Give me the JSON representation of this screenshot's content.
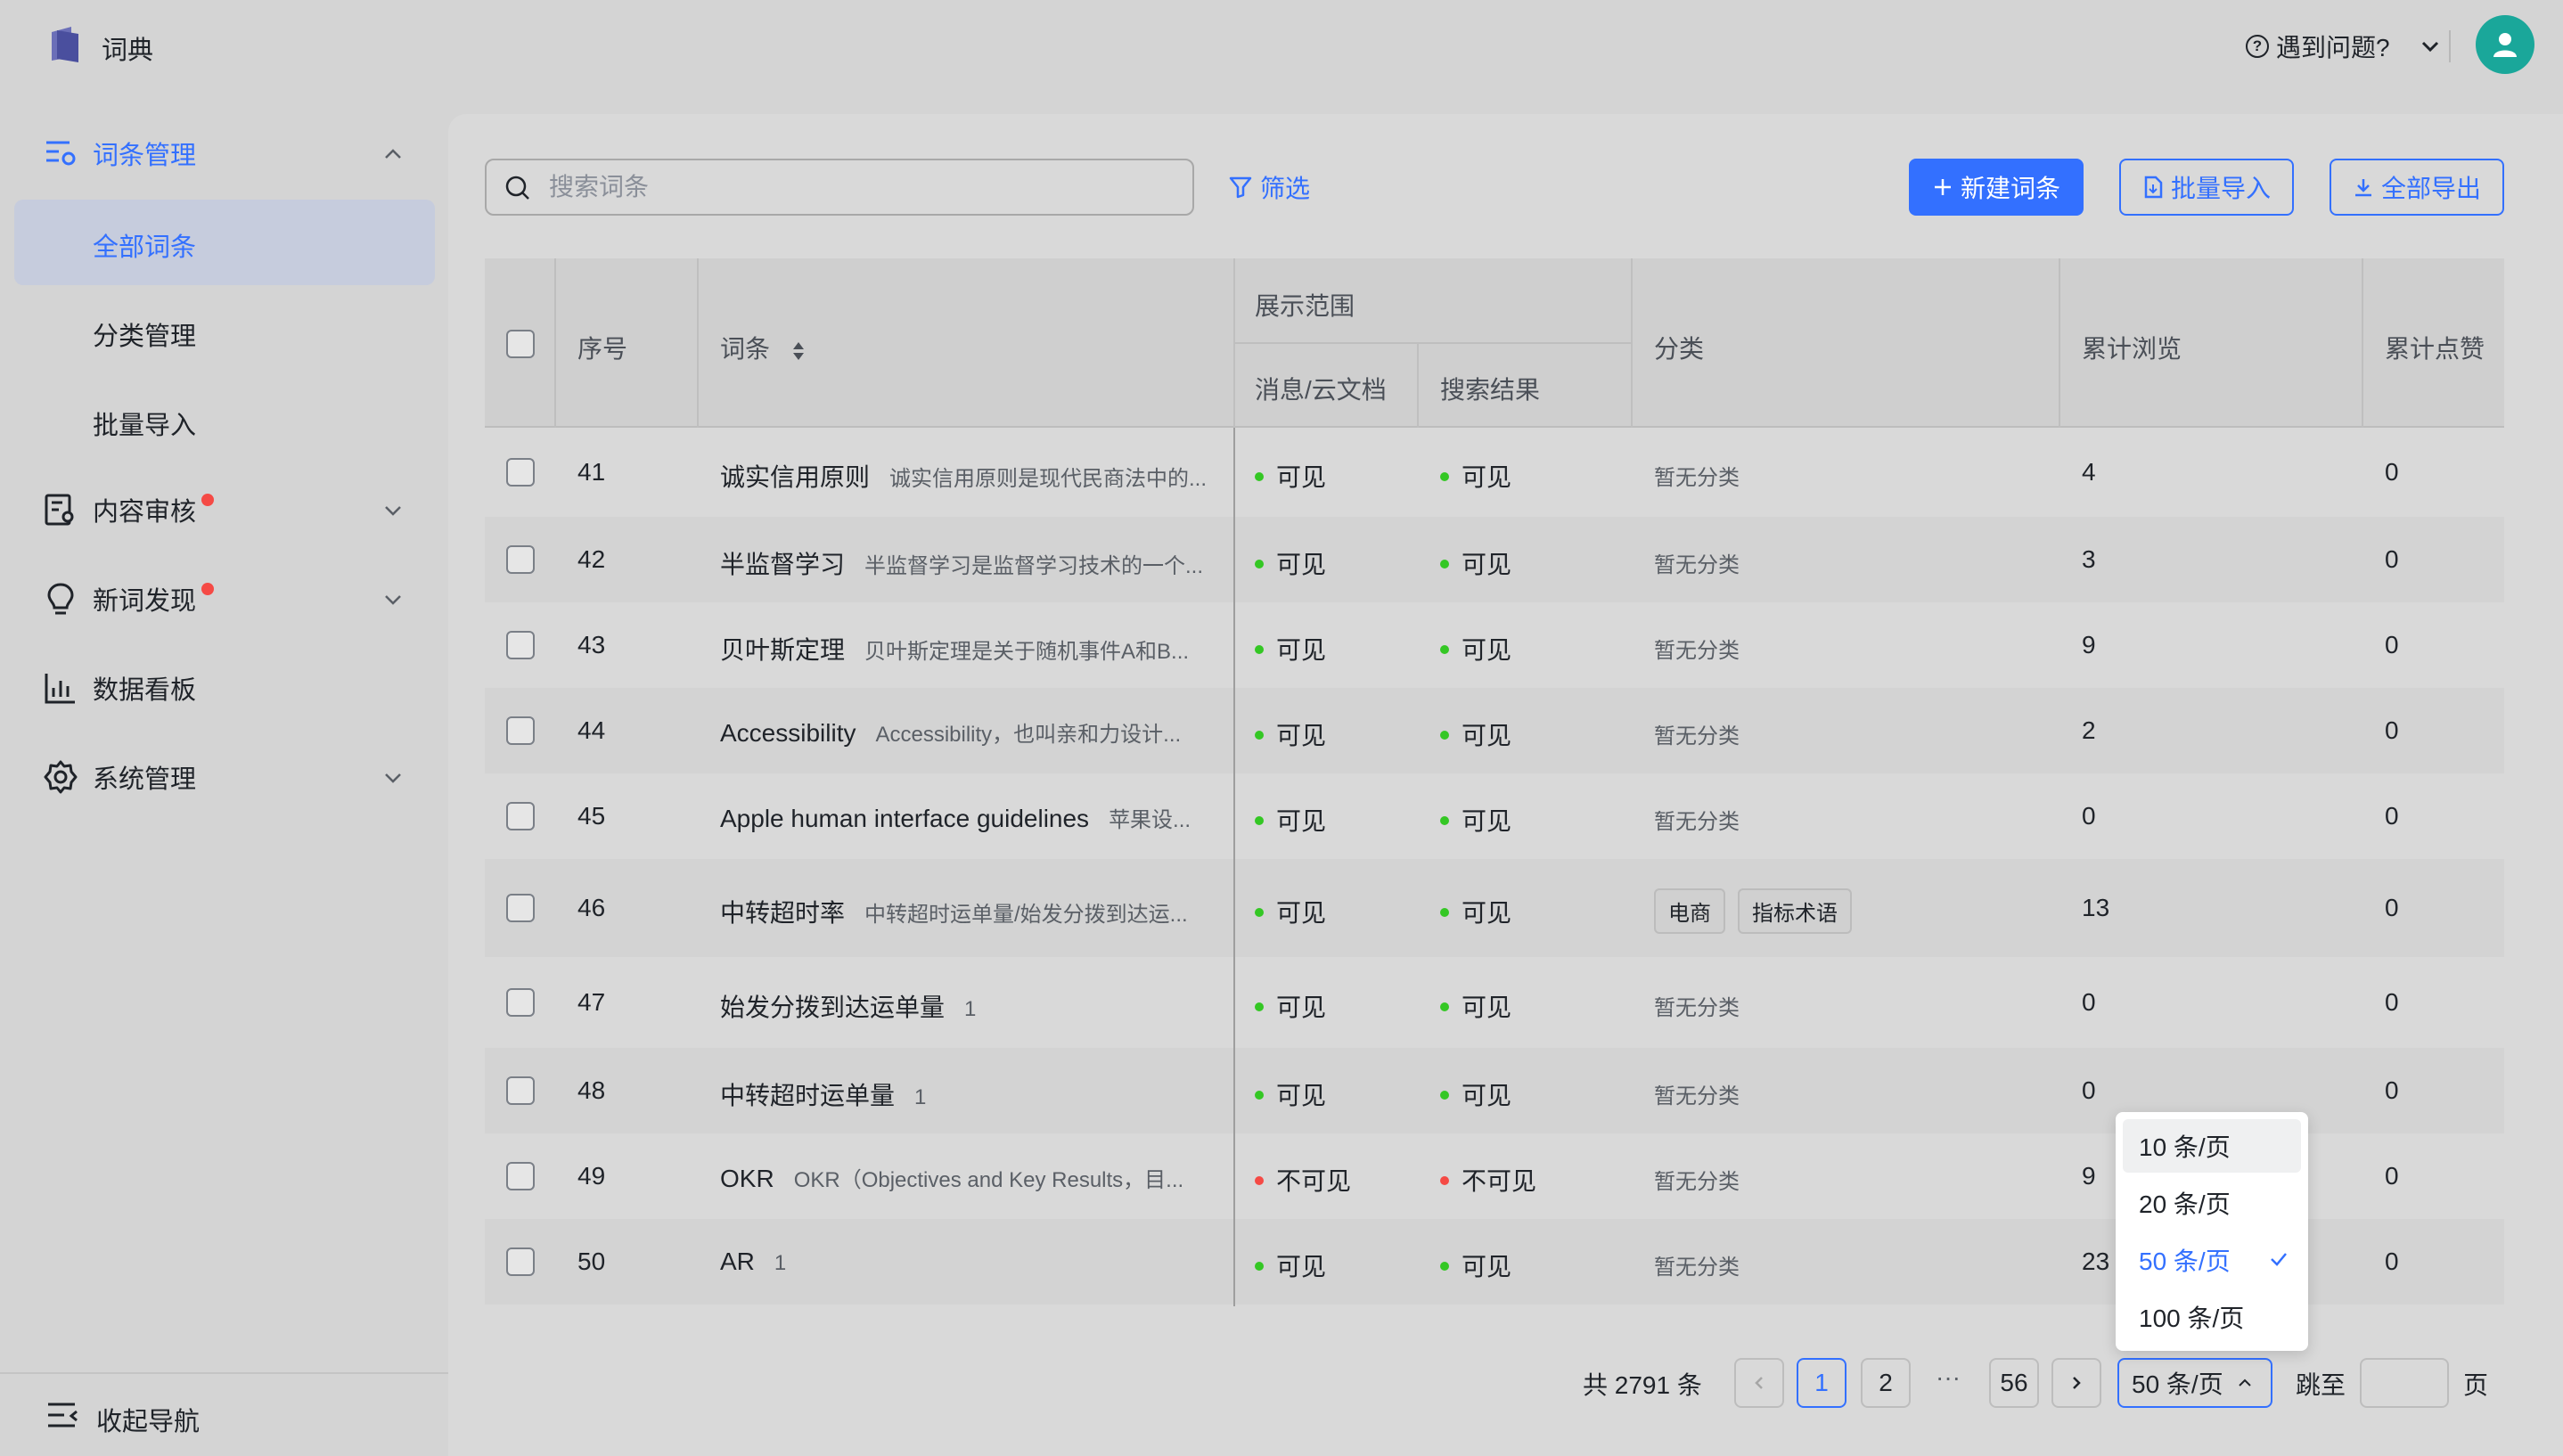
{
  "header": {
    "app_title": "词典",
    "help_label": "遇到问题?"
  },
  "sidebar": {
    "items": [
      {
        "label": "词条管理",
        "icon": "list-settings-icon",
        "expanded": true,
        "badge": false
      },
      {
        "label": "内容审核",
        "icon": "audit-icon",
        "expanded": false,
        "badge": true
      },
      {
        "label": "新词发现",
        "icon": "lightbulb-icon",
        "expanded": false,
        "badge": true
      },
      {
        "label": "数据看板",
        "icon": "bar-chart-icon",
        "badge": false
      },
      {
        "label": "系统管理",
        "icon": "gear-icon",
        "expanded": false,
        "badge": false
      }
    ],
    "sub_items": [
      {
        "label": "全部词条",
        "selected": true
      },
      {
        "label": "分类管理",
        "selected": false
      },
      {
        "label": "批量导入",
        "selected": false
      }
    ],
    "collapse_label": "收起导航"
  },
  "toolbar": {
    "search_placeholder": "搜索词条",
    "filter_label": "筛选",
    "new_label": "新建词条",
    "import_label": "批量导入",
    "export_label": "全部导出"
  },
  "table": {
    "headers": {
      "index": "序号",
      "term": "词条",
      "scope": "展示范围",
      "scope_msg": "消息/云文档",
      "scope_search": "搜索结果",
      "category": "分类",
      "views": "累计浏览",
      "likes": "累计点赞"
    },
    "rows": [
      {
        "index": "41",
        "term": "诚实信用原则",
        "desc": "诚实信用原则是现代民商法中的...",
        "msg": "可见",
        "msg_ok": true,
        "search": "可见",
        "search_ok": true,
        "category": "暂无分类",
        "tags": [],
        "views": "4",
        "likes": "0"
      },
      {
        "index": "42",
        "term": "半监督学习",
        "desc": "半监督学习是监督学习技术的一个...",
        "msg": "可见",
        "msg_ok": true,
        "search": "可见",
        "search_ok": true,
        "category": "暂无分类",
        "tags": [],
        "views": "3",
        "likes": "0"
      },
      {
        "index": "43",
        "term": "贝叶斯定理",
        "desc": "贝叶斯定理是关于随机事件A和B...",
        "msg": "可见",
        "msg_ok": true,
        "search": "可见",
        "search_ok": true,
        "category": "暂无分类",
        "tags": [],
        "views": "9",
        "likes": "0"
      },
      {
        "index": "44",
        "term": "Accessibility",
        "desc": "Accessibility，也叫亲和力设计...",
        "msg": "可见",
        "msg_ok": true,
        "search": "可见",
        "search_ok": true,
        "category": "暂无分类",
        "tags": [],
        "views": "2",
        "likes": "0"
      },
      {
        "index": "45",
        "term": "Apple human interface guidelines",
        "desc": "苹果设...",
        "msg": "可见",
        "msg_ok": true,
        "search": "可见",
        "search_ok": true,
        "category": "暂无分类",
        "tags": [],
        "views": "0",
        "likes": "0"
      },
      {
        "index": "46",
        "term": "中转超时率",
        "desc": "中转超时运单量/始发分拨到达运...",
        "msg": "可见",
        "msg_ok": true,
        "search": "可见",
        "search_ok": true,
        "category": "",
        "tags": [
          "电商",
          "指标术语"
        ],
        "views": "13",
        "likes": "0"
      },
      {
        "index": "47",
        "term": "始发分拨到达运单量",
        "desc": "1",
        "msg": "可见",
        "msg_ok": true,
        "search": "可见",
        "search_ok": true,
        "category": "暂无分类",
        "tags": [],
        "views": "0",
        "likes": "0"
      },
      {
        "index": "48",
        "term": "中转超时运单量",
        "desc": "1",
        "msg": "可见",
        "msg_ok": true,
        "search": "可见",
        "search_ok": true,
        "category": "暂无分类",
        "tags": [],
        "views": "0",
        "likes": "0"
      },
      {
        "index": "49",
        "term": "OKR",
        "desc": "OKR（Objectives and Key Results，目...",
        "msg": "不可见",
        "msg_ok": false,
        "search": "不可见",
        "search_ok": false,
        "category": "暂无分类",
        "tags": [],
        "views": "9",
        "likes": "0"
      },
      {
        "index": "50",
        "term": "AR",
        "desc": "1",
        "msg": "可见",
        "msg_ok": true,
        "search": "可见",
        "search_ok": true,
        "category": "暂无分类",
        "tags": [],
        "views": "23",
        "likes": "0"
      }
    ]
  },
  "pagination": {
    "total_label": "共 2791 条",
    "pages": [
      "1",
      "2",
      "56"
    ],
    "current_page": "1",
    "ellipsis": "···",
    "page_size_label": "50 条/页",
    "goto_label": "跳至",
    "page_suffix": "页"
  },
  "page_size_dropdown": {
    "options": [
      "10 条/页",
      "20 条/页",
      "50 条/页",
      "100 条/页"
    ],
    "selected": "50 条/页",
    "hovered": "10 条/页"
  },
  "colors": {
    "accent": "#3370ff",
    "visible": "#34c724",
    "hidden": "#f54a45",
    "avatar": "#1aa79a"
  }
}
